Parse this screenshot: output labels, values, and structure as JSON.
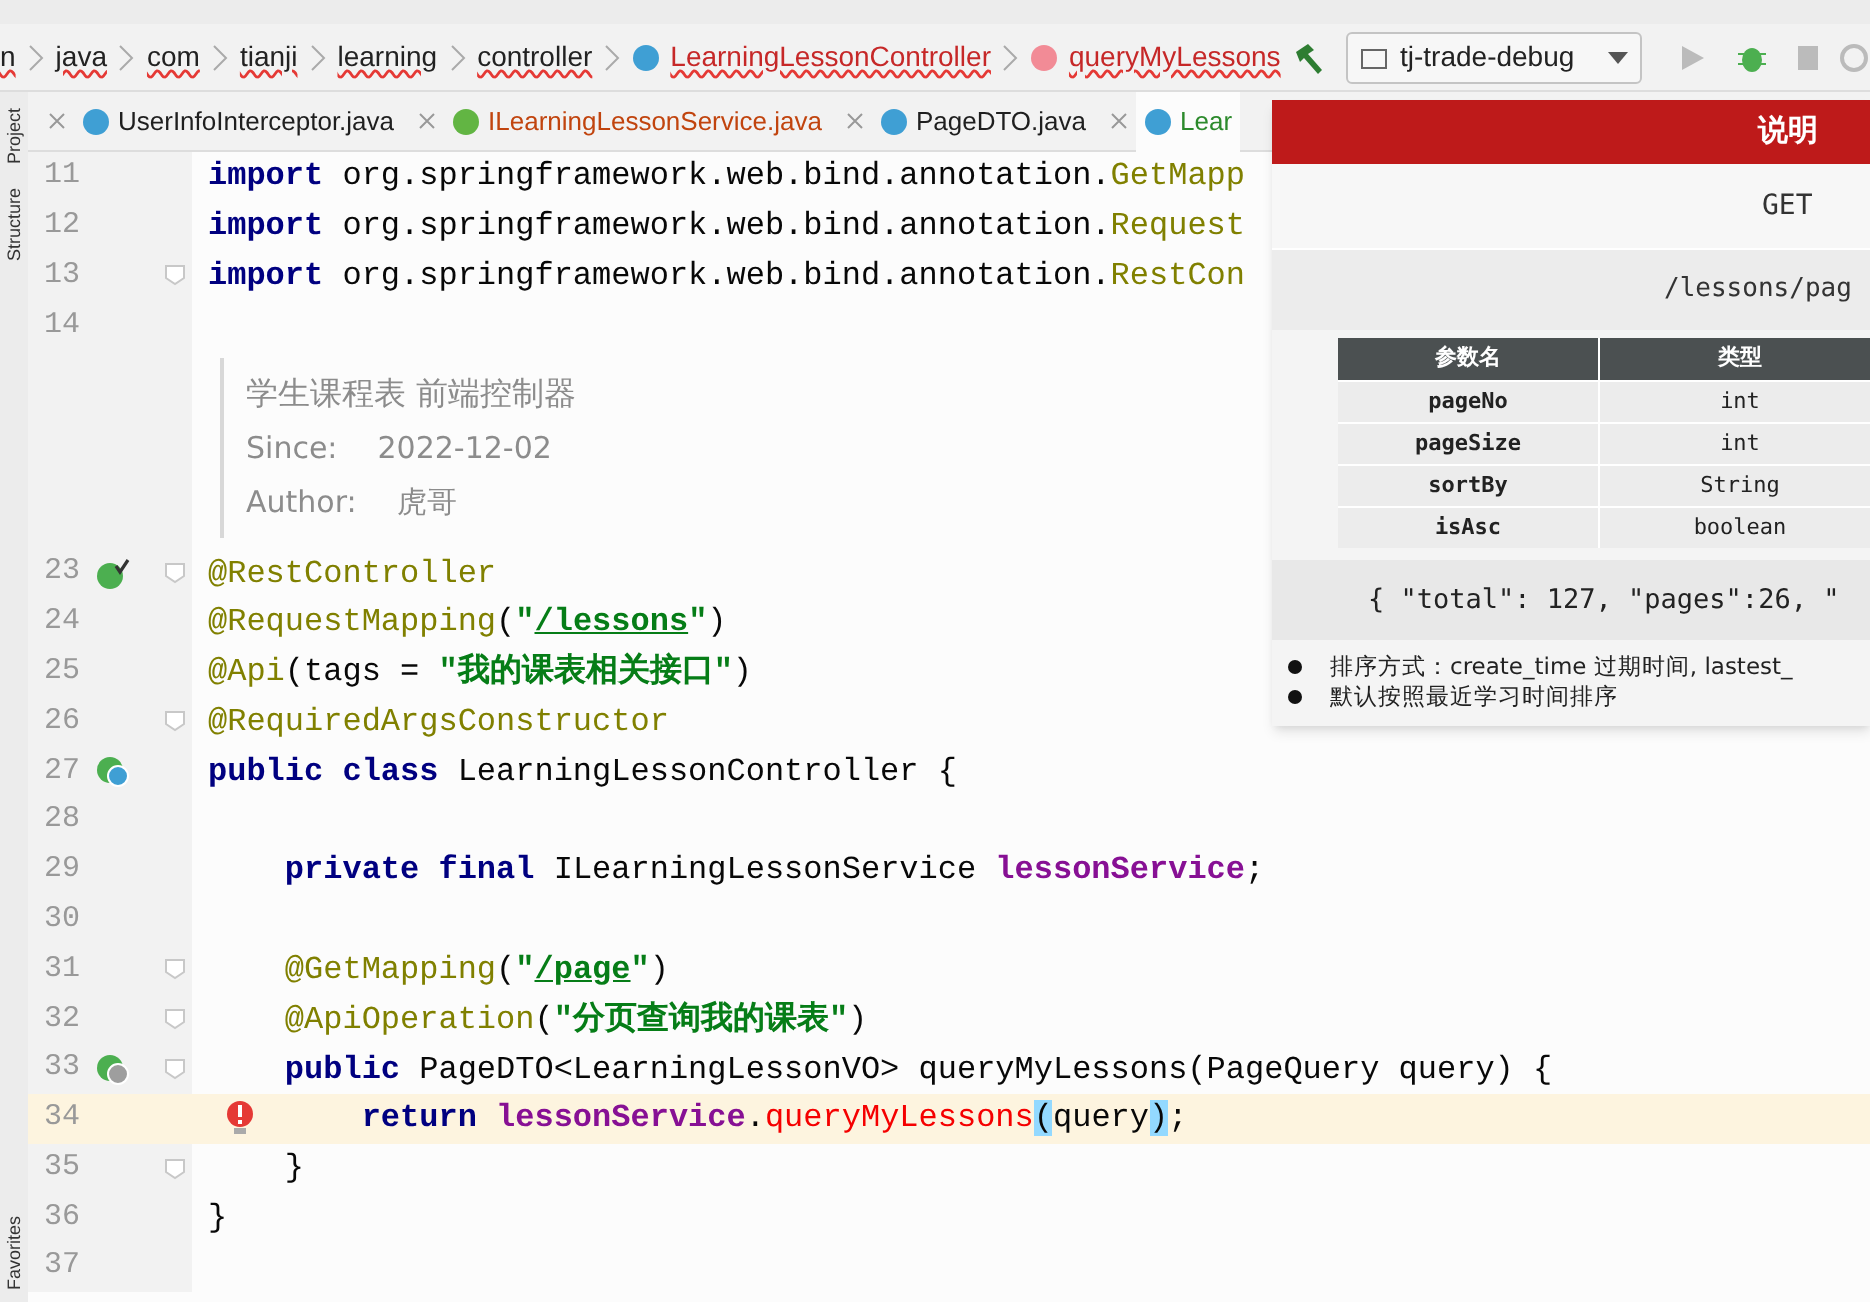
{
  "breadcrumb": [
    {
      "label": "n",
      "kind": "package"
    },
    {
      "label": "java",
      "kind": "package"
    },
    {
      "label": "com",
      "kind": "package"
    },
    {
      "label": "tianji",
      "kind": "package"
    },
    {
      "label": "learning",
      "kind": "package"
    },
    {
      "label": "controller",
      "kind": "package"
    },
    {
      "label": "LearningLessonController",
      "kind": "class"
    },
    {
      "label": "queryMyLessons",
      "kind": "method"
    }
  ],
  "toolbar": {
    "run_config": "tj-trade-debug"
  },
  "side_tabs": [
    {
      "label": "Project",
      "kind": "top"
    },
    {
      "label": "Structure",
      "kind": "top"
    },
    {
      "label": "Favorites",
      "kind": "bottom"
    }
  ],
  "tabs": [
    {
      "label": "UserInfoInterceptor.java",
      "kind": "class",
      "color": "#1f1f1f",
      "selected": false
    },
    {
      "label": "ILearningLessonService.java",
      "kind": "interface",
      "color": "#c1440e",
      "selected": false
    },
    {
      "label": "PageDTO.java",
      "kind": "class",
      "color": "#1f1f1f",
      "selected": false
    },
    {
      "label": "Lear",
      "kind": "class",
      "color": "#2c8a2c",
      "selected": true
    }
  ],
  "lines": [
    {
      "kind": "code",
      "number": "11",
      "tokens": [
        {
          "kind": "keyword",
          "text": "import"
        },
        {
          "kind": "plain",
          "text": " org.springframework.web.bind.annotation."
        },
        {
          "kind": "annotation",
          "text": "GetMapp"
        }
      ]
    },
    {
      "kind": "code",
      "number": "12",
      "tokens": [
        {
          "kind": "keyword",
          "text": "import"
        },
        {
          "kind": "plain",
          "text": " org.springframework.web.bind.annotation."
        },
        {
          "kind": "annotation",
          "text": "Request"
        }
      ]
    },
    {
      "kind": "code",
      "number": "13",
      "fold": true,
      "tokens": [
        {
          "kind": "keyword",
          "text": "import"
        },
        {
          "kind": "plain",
          "text": " org.springframework.web.bind.annotation."
        },
        {
          "kind": "annotation",
          "text": "RestCon"
        }
      ]
    },
    {
      "kind": "code",
      "number": "14"
    },
    {
      "kind": "doc",
      "summary": "学生课程表 前端控制器",
      "fields": [
        {
          "label": "Since:",
          "value": "2022-12-02"
        },
        {
          "label": "Author:",
          "value": "虎哥"
        }
      ]
    },
    {
      "kind": "code",
      "number": "23",
      "marker": {
        "kind": "bean"
      },
      "fold": true,
      "tokens": [
        {
          "kind": "annotation",
          "text": "@RestController"
        }
      ]
    },
    {
      "kind": "code",
      "number": "24",
      "tokens": [
        {
          "kind": "annotation",
          "text": "@RequestMapping"
        },
        {
          "kind": "plain",
          "text": "("
        },
        {
          "kind": "string",
          "text": "\""
        },
        {
          "kind": "url",
          "text": "/lessons"
        },
        {
          "kind": "string",
          "text": "\""
        },
        {
          "kind": "plain",
          "text": ")"
        }
      ]
    },
    {
      "kind": "code",
      "number": "25",
      "tokens": [
        {
          "kind": "annotation",
          "text": "@Api"
        },
        {
          "kind": "plain",
          "text": "(tags = "
        },
        {
          "kind": "string",
          "text": "\"我的课表相关接口\""
        },
        {
          "kind": "plain",
          "text": ")"
        }
      ]
    },
    {
      "kind": "code",
      "number": "26",
      "fold": true,
      "tokens": [
        {
          "kind": "annotation",
          "text": "@RequiredArgsConstructor"
        }
      ]
    },
    {
      "kind": "code",
      "number": "27",
      "marker": {
        "kind": "class-bean"
      },
      "tokens": [
        {
          "kind": "keyword",
          "text": "public class"
        },
        {
          "kind": "plain",
          "text": " LearningLessonController {"
        }
      ]
    },
    {
      "kind": "code",
      "number": "28"
    },
    {
      "kind": "code",
      "number": "29",
      "tokens": [
        {
          "kind": "keyword",
          "text": "    private final"
        },
        {
          "kind": "plain",
          "text": " ILearningLessonService "
        },
        {
          "kind": "field",
          "text": "lessonService"
        },
        {
          "kind": "plain",
          "text": ";"
        }
      ]
    },
    {
      "kind": "code",
      "number": "30"
    },
    {
      "kind": "code",
      "number": "31",
      "fold": true,
      "tokens": [
        {
          "kind": "annotation",
          "text": "    @GetMapping"
        },
        {
          "kind": "plain",
          "text": "("
        },
        {
          "kind": "string",
          "text": "\""
        },
        {
          "kind": "url",
          "text": "/page"
        },
        {
          "kind": "string",
          "text": "\""
        },
        {
          "kind": "plain",
          "text": ")"
        }
      ]
    },
    {
      "kind": "code",
      "number": "32",
      "fold": true,
      "tokens": [
        {
          "kind": "annotation",
          "text": "    @ApiOperation"
        },
        {
          "kind": "plain",
          "text": "("
        },
        {
          "kind": "string",
          "text": "\"分页查询我的课表\""
        },
        {
          "kind": "plain",
          "text": ")"
        }
      ]
    },
    {
      "kind": "code",
      "number": "33",
      "marker": {
        "kind": "method-bean"
      },
      "fold": true,
      "tokens": [
        {
          "kind": "keyword",
          "text": "    public"
        },
        {
          "kind": "plain",
          "text": " PageDTO<LearningLessonVO> queryMyLessons(PageQuery query) {"
        }
      ]
    },
    {
      "kind": "code",
      "number": "34",
      "current": true,
      "error": true,
      "tokens": [
        {
          "kind": "keyword",
          "text": "        return"
        },
        {
          "kind": "field",
          "text": " lessonService"
        },
        {
          "kind": "plain",
          "text": "."
        },
        {
          "kind": "error",
          "text": "queryMyLessons"
        },
        {
          "kind": "brace",
          "text": "("
        },
        {
          "kind": "plain",
          "text": "query"
        },
        {
          "kind": "brace",
          "text": ")"
        },
        {
          "kind": "plain",
          "text": ";"
        }
      ]
    },
    {
      "kind": "code",
      "number": "35",
      "fold": true,
      "tokens": [
        {
          "kind": "plain",
          "text": "    }"
        }
      ]
    },
    {
      "kind": "code",
      "number": "36",
      "tokens": [
        {
          "kind": "plain",
          "text": "}"
        }
      ]
    },
    {
      "kind": "code",
      "number": "37"
    }
  ],
  "popup": {
    "title": "说明",
    "method": "GET",
    "path": "/lessons/pag",
    "columns": [
      "参数名",
      "类型"
    ],
    "rows": [
      [
        "pageNo",
        "int"
      ],
      [
        "pageSize",
        "int"
      ],
      [
        "sortBy",
        "String"
      ],
      [
        "isAsc",
        "boolean"
      ]
    ],
    "response": "{ \"total\": 127, \"pages\":26, \"",
    "notes": [
      "排序方式：create_time 过期时间, lastest_",
      "默认按照最近学习时间排序"
    ]
  }
}
